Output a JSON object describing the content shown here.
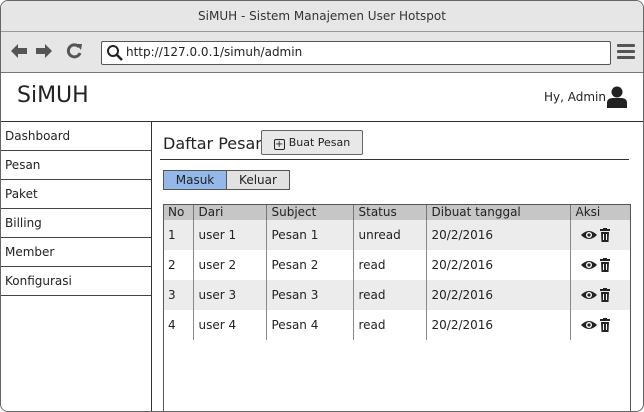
{
  "window": {
    "title": "SiMUH - Sistem Manajemen User Hotspot"
  },
  "browser": {
    "url": "http://127.0.0.1/simuh/admin",
    "back_icon": "arrow-left-icon",
    "forward_icon": "arrow-right-icon",
    "reload_icon": "reload-icon",
    "menu_icon": "hamburger-menu-icon"
  },
  "header": {
    "brand": "SiMUH",
    "greeting": "Hy, Admin",
    "user_icon": "user-icon"
  },
  "sidebar": {
    "items": [
      {
        "label": "Dashboard"
      },
      {
        "label": "Pesan"
      },
      {
        "label": "Paket"
      },
      {
        "label": "Billing"
      },
      {
        "label": "Member"
      },
      {
        "label": "Konfigurasi"
      }
    ]
  },
  "main": {
    "title": "Daftar Pesan",
    "new_button": "Buat Pesan",
    "tabs": [
      {
        "label": "Masuk",
        "active": true
      },
      {
        "label": "Keluar",
        "active": false
      }
    ],
    "table": {
      "columns": [
        "No",
        "Dari",
        "Subject",
        "Status",
        "Dibuat tanggal",
        "Aksi"
      ],
      "rows": [
        [
          "1",
          "user 1",
          "Pesan 1",
          "unread",
          "20/2/2016"
        ],
        [
          "2",
          "user 2",
          "Pesan 2",
          "read",
          "20/2/2016"
        ],
        [
          "3",
          "user 3",
          "Pesan 3",
          "read",
          "20/2/2016"
        ],
        [
          "4",
          "user 4",
          "Pesan 4",
          "read",
          "20/2/2016"
        ]
      ],
      "action_icons": [
        "eye-icon",
        "trash-icon"
      ]
    }
  },
  "colors": {
    "active_tab": "#94b8ea",
    "chrome": "#e6e6e6",
    "table_header": "#c6c6c6",
    "row_alt": "#ececec"
  }
}
